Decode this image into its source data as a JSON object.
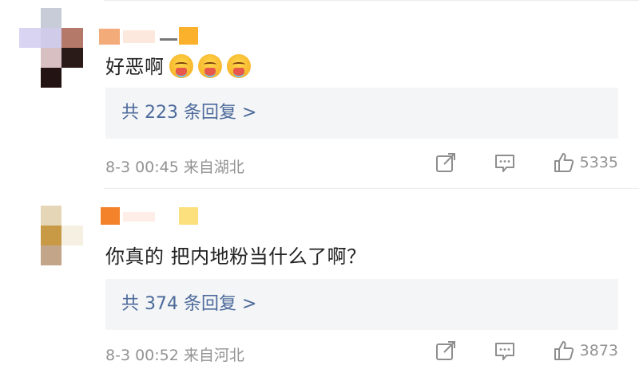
{
  "comments": [
    {
      "text": "好恶啊",
      "emoji_count": 3,
      "emoji_name": "vomit-emoji",
      "replies_label": "共 223 条回复 >",
      "timestamp_location": "8-3 00:45  来自湖北",
      "likes": "5335"
    },
    {
      "text": "你真的 把内地粉当什么了啊？",
      "replies_label": "共 374 条回复 >",
      "timestamp_location": "8-3 00:52  来自河北",
      "likes": "3873"
    }
  ],
  "icons": {
    "share": "share-icon",
    "comment": "comment-icon",
    "like": "thumbs-up-icon"
  },
  "colors": {
    "link": "#4c6a9b",
    "meta": "#939393",
    "text": "#222222",
    "reply_bg": "#f4f5f7"
  }
}
